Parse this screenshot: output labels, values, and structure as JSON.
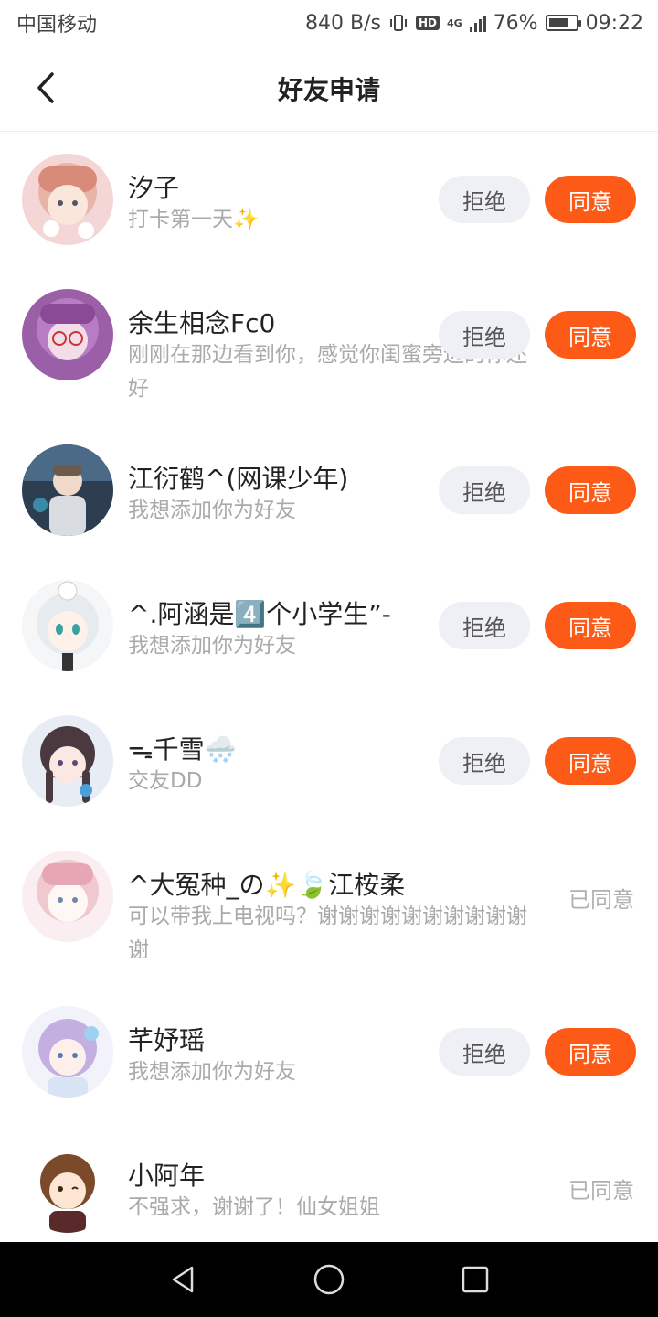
{
  "status_bar": {
    "carrier": "中国移动",
    "speed": "840 B/s",
    "hd": "HD",
    "network": "4G",
    "battery_text": "76%",
    "battery_level": 0.76,
    "time": "09:22"
  },
  "header": {
    "title": "好友申请"
  },
  "requests": [
    {
      "name": "汐子",
      "message": "打卡第一天✨",
      "reject_label": "拒绝",
      "agree_label": "同意",
      "status": "pending"
    },
    {
      "name": "余生相念Fc0",
      "message": "刚刚在那边看到你，感觉你闺蜜旁边的你还好",
      "reject_label": "拒绝",
      "agree_label": "同意",
      "status": "pending"
    },
    {
      "name": "江衍鹤^(网课少年)",
      "message": "我想添加你为好友",
      "reject_label": "拒绝",
      "agree_label": "同意",
      "status": "pending"
    },
    {
      "name": "^.阿涵是4️⃣个小学生”-",
      "message": "我想添加你为好友",
      "reject_label": "拒绝",
      "agree_label": "同意",
      "status": "pending"
    },
    {
      "name": "ᯓ千雪🌨️",
      "message": "交友DD",
      "reject_label": "拒绝",
      "agree_label": "同意",
      "status": "pending"
    },
    {
      "name": "^大冤种_の✨🍃江桉柔",
      "message": "可以带我上电视吗？谢谢谢谢谢谢谢谢谢谢谢",
      "status_label": "已同意",
      "status": "agreed"
    },
    {
      "name": "芊妤瑶",
      "message": "我想添加你为好友",
      "reject_label": "拒绝",
      "agree_label": "同意",
      "status": "pending"
    },
    {
      "name": "小阿年",
      "message": "不强求，谢谢了！仙女姐姐",
      "status_label": "已同意",
      "status": "agreed"
    }
  ],
  "colors": {
    "accent": "#fc5a16",
    "reject_bg": "#eef0f5",
    "muted_text": "#aaaaaa"
  },
  "icons": {
    "back": "back-arrow-icon",
    "nav_back": "triangle-back-icon",
    "nav_home": "circle-home-icon",
    "nav_recent": "square-recent-icon"
  }
}
